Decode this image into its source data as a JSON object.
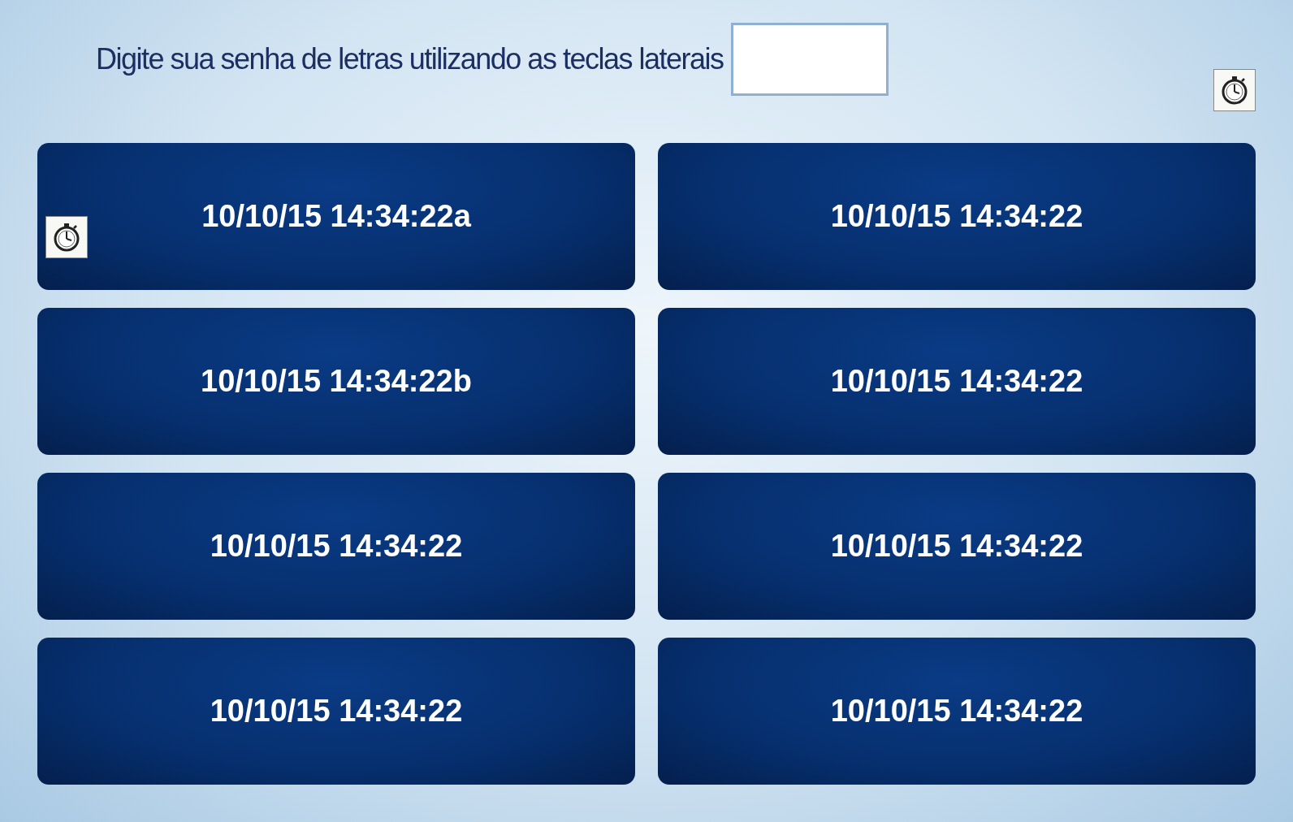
{
  "prompt": "Digite sua senha de letras utilizando as teclas laterais",
  "buttons": [
    {
      "label": "10/10/15 14:34:22a",
      "timer": true
    },
    {
      "label": "10/10/15 14:34:22",
      "timer": false
    },
    {
      "label": "10/10/15 14:34:22b",
      "timer": false
    },
    {
      "label": "10/10/15 14:34:22",
      "timer": false
    },
    {
      "label": "10/10/15 14:34:22",
      "timer": false
    },
    {
      "label": "10/10/15 14:34:22",
      "timer": false
    },
    {
      "label": "10/10/15 14:34:22",
      "timer": false
    },
    {
      "label": "10/10/15 14:34:22",
      "timer": false
    }
  ]
}
